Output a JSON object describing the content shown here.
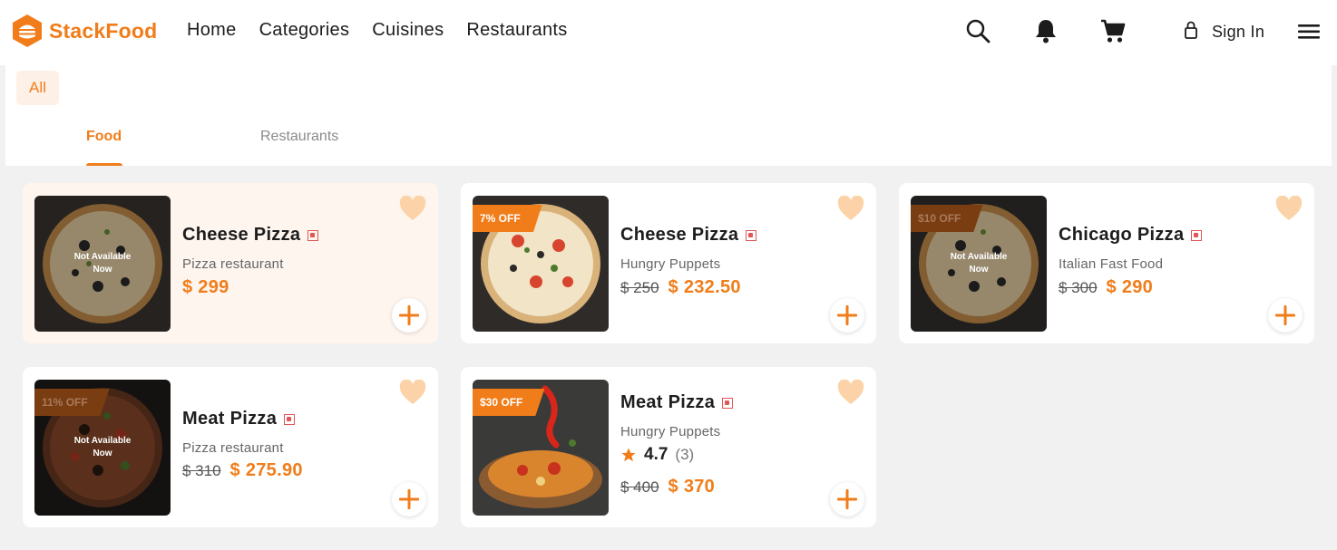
{
  "brand": {
    "name": "StackFood",
    "accent": "#f07d1a"
  },
  "nav": {
    "items": [
      "Home",
      "Categories",
      "Cuisines",
      "Restaurants"
    ]
  },
  "header_icons": [
    "search-icon",
    "bell-icon",
    "cart-icon",
    "menu-icon"
  ],
  "signin": {
    "label": "Sign In"
  },
  "filters": {
    "active": "All"
  },
  "tabs": {
    "food": "Food",
    "restaurants": "Restaurants"
  },
  "cards": [
    {
      "name": "Cheese Pizza",
      "restaurant": "Pizza restaurant",
      "old_price": "",
      "price": "$ 299",
      "discount": "",
      "unavailable": "Not Available Now",
      "rating": "",
      "rating_count": ""
    },
    {
      "name": "Cheese Pizza",
      "restaurant": "Hungry Puppets",
      "old_price": "$ 250",
      "price": "$ 232.50",
      "discount": "7% OFF",
      "unavailable": "",
      "rating": "",
      "rating_count": ""
    },
    {
      "name": "Chicago Pizza",
      "restaurant": "Italian Fast Food",
      "old_price": "$ 300",
      "price": "$ 290",
      "discount": "$10 OFF",
      "unavailable": "Not Available Now",
      "rating": "",
      "rating_count": ""
    },
    {
      "name": "Meat Pizza",
      "restaurant": "Pizza restaurant",
      "old_price": "$ 310",
      "price": "$ 275.90",
      "discount": "11% OFF",
      "unavailable": "Not Available Now",
      "rating": "",
      "rating_count": ""
    },
    {
      "name": "Meat Pizza",
      "restaurant": "Hungry Puppets",
      "old_price": "$ 400",
      "price": "$ 370",
      "discount": "$30 OFF",
      "unavailable": "",
      "rating": "4.7",
      "rating_count": "(3)"
    }
  ]
}
